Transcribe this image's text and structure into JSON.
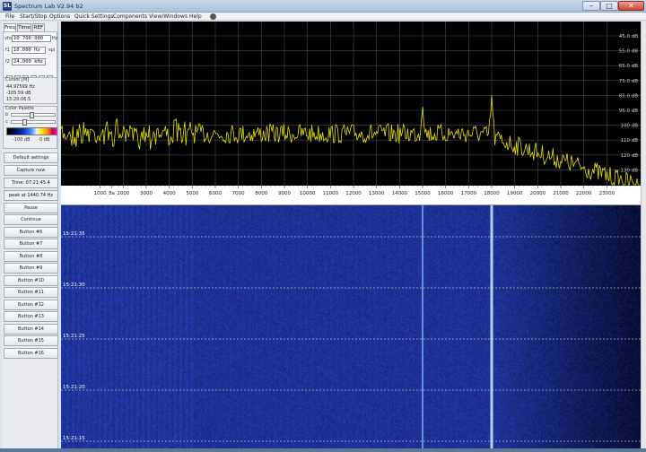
{
  "window": {
    "title": "Spectrum Lab V2.94 b2",
    "icon_text": "SL"
  },
  "titlebar_buttons": {
    "minimize": "–",
    "maximize": "□",
    "close": "✕"
  },
  "menu": [
    "File",
    "Start/Stop",
    "Options",
    "Quick Settings",
    "Components",
    "View/Windows",
    "Help"
  ],
  "tabs": [
    "Freq",
    "Time",
    "REF"
  ],
  "freq_fields": {
    "vfo": {
      "label": "vfo",
      "value": "10 700 000",
      "unit": "Hz"
    },
    "f1": {
      "label": "f1",
      "value": "10.000 Hz",
      "unit": "spl"
    },
    "f2": {
      "label": "f2",
      "value": "24.000 kHz",
      "unit": ""
    },
    "nav_buttons": [
      "<",
      ">",
      "«",
      "»",
      "<",
      ">"
    ]
  },
  "cursor": {
    "title": "Cursor [M]",
    "lines": [
      "44.97599 Hz",
      "-105.59 dB",
      "15:20:06.5"
    ]
  },
  "palette": {
    "title": "Color Palette",
    "b_label": "b",
    "c_label": "c",
    "min_label": "-100 dB",
    "max_label": "0 dB"
  },
  "buttons": {
    "default_settings": "Default settings",
    "capture_now": "Capture now",
    "time": "Time:  07:21:45.4",
    "peak": "peak at 1440.74 Hz",
    "pause": "Pause",
    "continue": "Continue",
    "user_buttons": [
      "Button #6",
      "Button #7",
      "Button #8",
      "Button #9",
      "Button #10",
      "Button #11",
      "Button #12",
      "Button #13",
      "Button #14",
      "Button #15",
      "Button #16"
    ]
  },
  "spectrum": {
    "db_labels": [
      "45.0 dB",
      "55.0 dB",
      "65.0 dB",
      "75.0 dB",
      "85.0 dB",
      "95.0 dB",
      "100 dB",
      "110 dB",
      "120 dB",
      "130 dB"
    ],
    "trace_color": "#e8e000",
    "peaks_hz": [
      15000,
      18000
    ]
  },
  "freq_axis": {
    "labels": [
      "1000",
      "8a",
      "2000",
      "3000",
      "4000",
      "5000",
      "6000",
      "7000",
      "8000",
      "9000",
      "10000",
      "11000",
      "12000",
      "13000",
      "14000",
      "15000",
      "16000",
      "17000",
      "18000",
      "19000",
      "20000",
      "21000",
      "22000",
      "23000"
    ]
  },
  "waterfall": {
    "timestamps": [
      "15:21:35",
      "15:21:30",
      "15:21:25",
      "15:21:20",
      "15:21:15"
    ],
    "line_freqs_hz": [
      15000,
      18000
    ]
  }
}
